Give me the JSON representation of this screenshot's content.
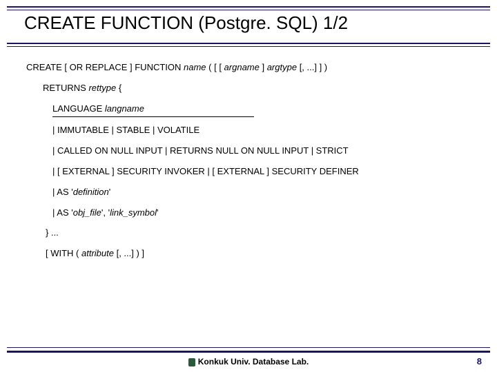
{
  "title": "CREATE FUNCTION (Postgre. SQL) 1/2",
  "syntax": {
    "l1a": "CREATE [ OR REPLACE ] FUNCTION ",
    "l1_name": "name",
    "l1b": " ( [ [ ",
    "l1_arg": "argname",
    "l1c": " ] ",
    "l1_type": "argtype",
    "l1d": " [, ...] ] )",
    "l2a": "RETURNS ",
    "l2_ret": "rettype ",
    "l2b": " {",
    "l3a": "LANGUAGE ",
    "l3_lang": "langname",
    "l4": "| IMMUTABLE | STABLE | VOLATILE",
    "l5": "| CALLED ON NULL INPUT | RETURNS NULL ON NULL INPUT | STRICT",
    "l6": "| [ EXTERNAL ] SECURITY INVOKER | [ EXTERNAL ] SECURITY DEFINER",
    "l7a": "| AS '",
    "l7_def": "definition",
    "l7b": "'",
    "l8a": "| AS '",
    "l8_obj": "obj_file",
    "l8b": "', '",
    "l8_link": "link_symbol",
    "l8c": "'",
    "l9": "} ...",
    "l10a": "[ WITH ( ",
    "l10_attr": "attribute",
    "l10b": " [, ...] ) ]"
  },
  "footer": "Konkuk Univ. Database Lab.",
  "page": "8"
}
